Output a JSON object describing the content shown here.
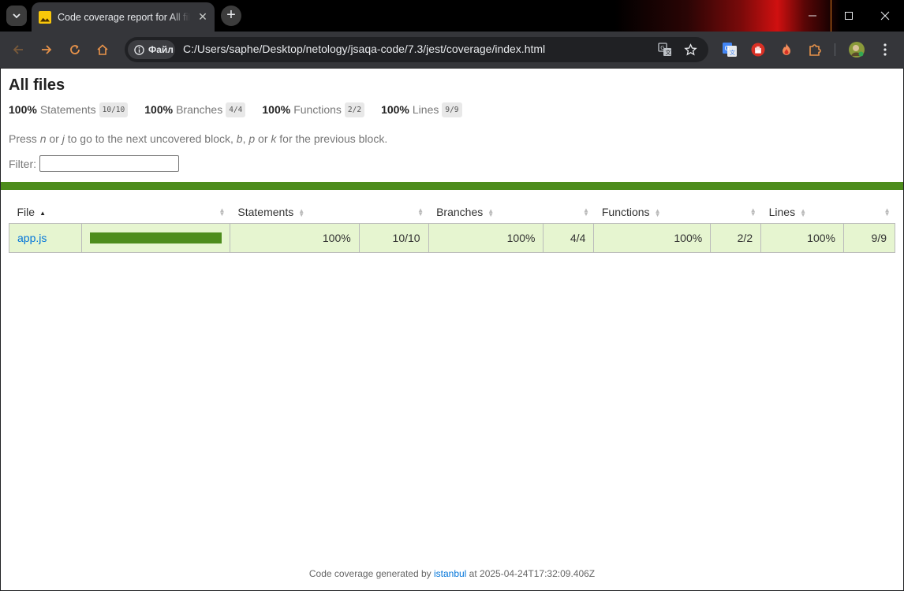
{
  "browser": {
    "tab_title": "Code coverage report for All files",
    "site_chip": "Файл",
    "url": "C:/Users/saphe/Desktop/netology/jsaqa-code/7.3/jest/coverage/index.html",
    "accent_colors": {
      "brand": "#f9c70a",
      "extension_red": "#d93025"
    }
  },
  "report": {
    "title": "All files",
    "summary": [
      {
        "pct": "100%",
        "label": "Statements",
        "fraction": "10/10"
      },
      {
        "pct": "100%",
        "label": "Branches",
        "fraction": "4/4"
      },
      {
        "pct": "100%",
        "label": "Functions",
        "fraction": "2/2"
      },
      {
        "pct": "100%",
        "label": "Lines",
        "fraction": "9/9"
      }
    ],
    "hint": {
      "press": "Press ",
      "n": "n",
      "or1": " or ",
      "j": "j",
      "next": " to go to the next uncovered block, ",
      "b": "b",
      "comma": ", ",
      "p": "p",
      "or2": " or ",
      "k": "k",
      "prev": " for the previous block."
    },
    "filter_label": "Filter:",
    "filter_value": "",
    "status_color": "#4d8c1c",
    "table": {
      "headers": {
        "file": "File",
        "statements": "Statements",
        "branches": "Branches",
        "functions": "Functions",
        "lines": "Lines"
      },
      "rows": [
        {
          "file": "app.js",
          "coverage_fraction": 1.0,
          "statements_pct": "100%",
          "statements_abs": "10/10",
          "branches_pct": "100%",
          "branches_abs": "4/4",
          "functions_pct": "100%",
          "functions_abs": "2/2",
          "lines_pct": "100%",
          "lines_abs": "9/9"
        }
      ]
    },
    "footer": {
      "prefix": "Code coverage generated by ",
      "link": "istanbul",
      "suffix": " at 2025-04-24T17:32:09.406Z"
    }
  }
}
